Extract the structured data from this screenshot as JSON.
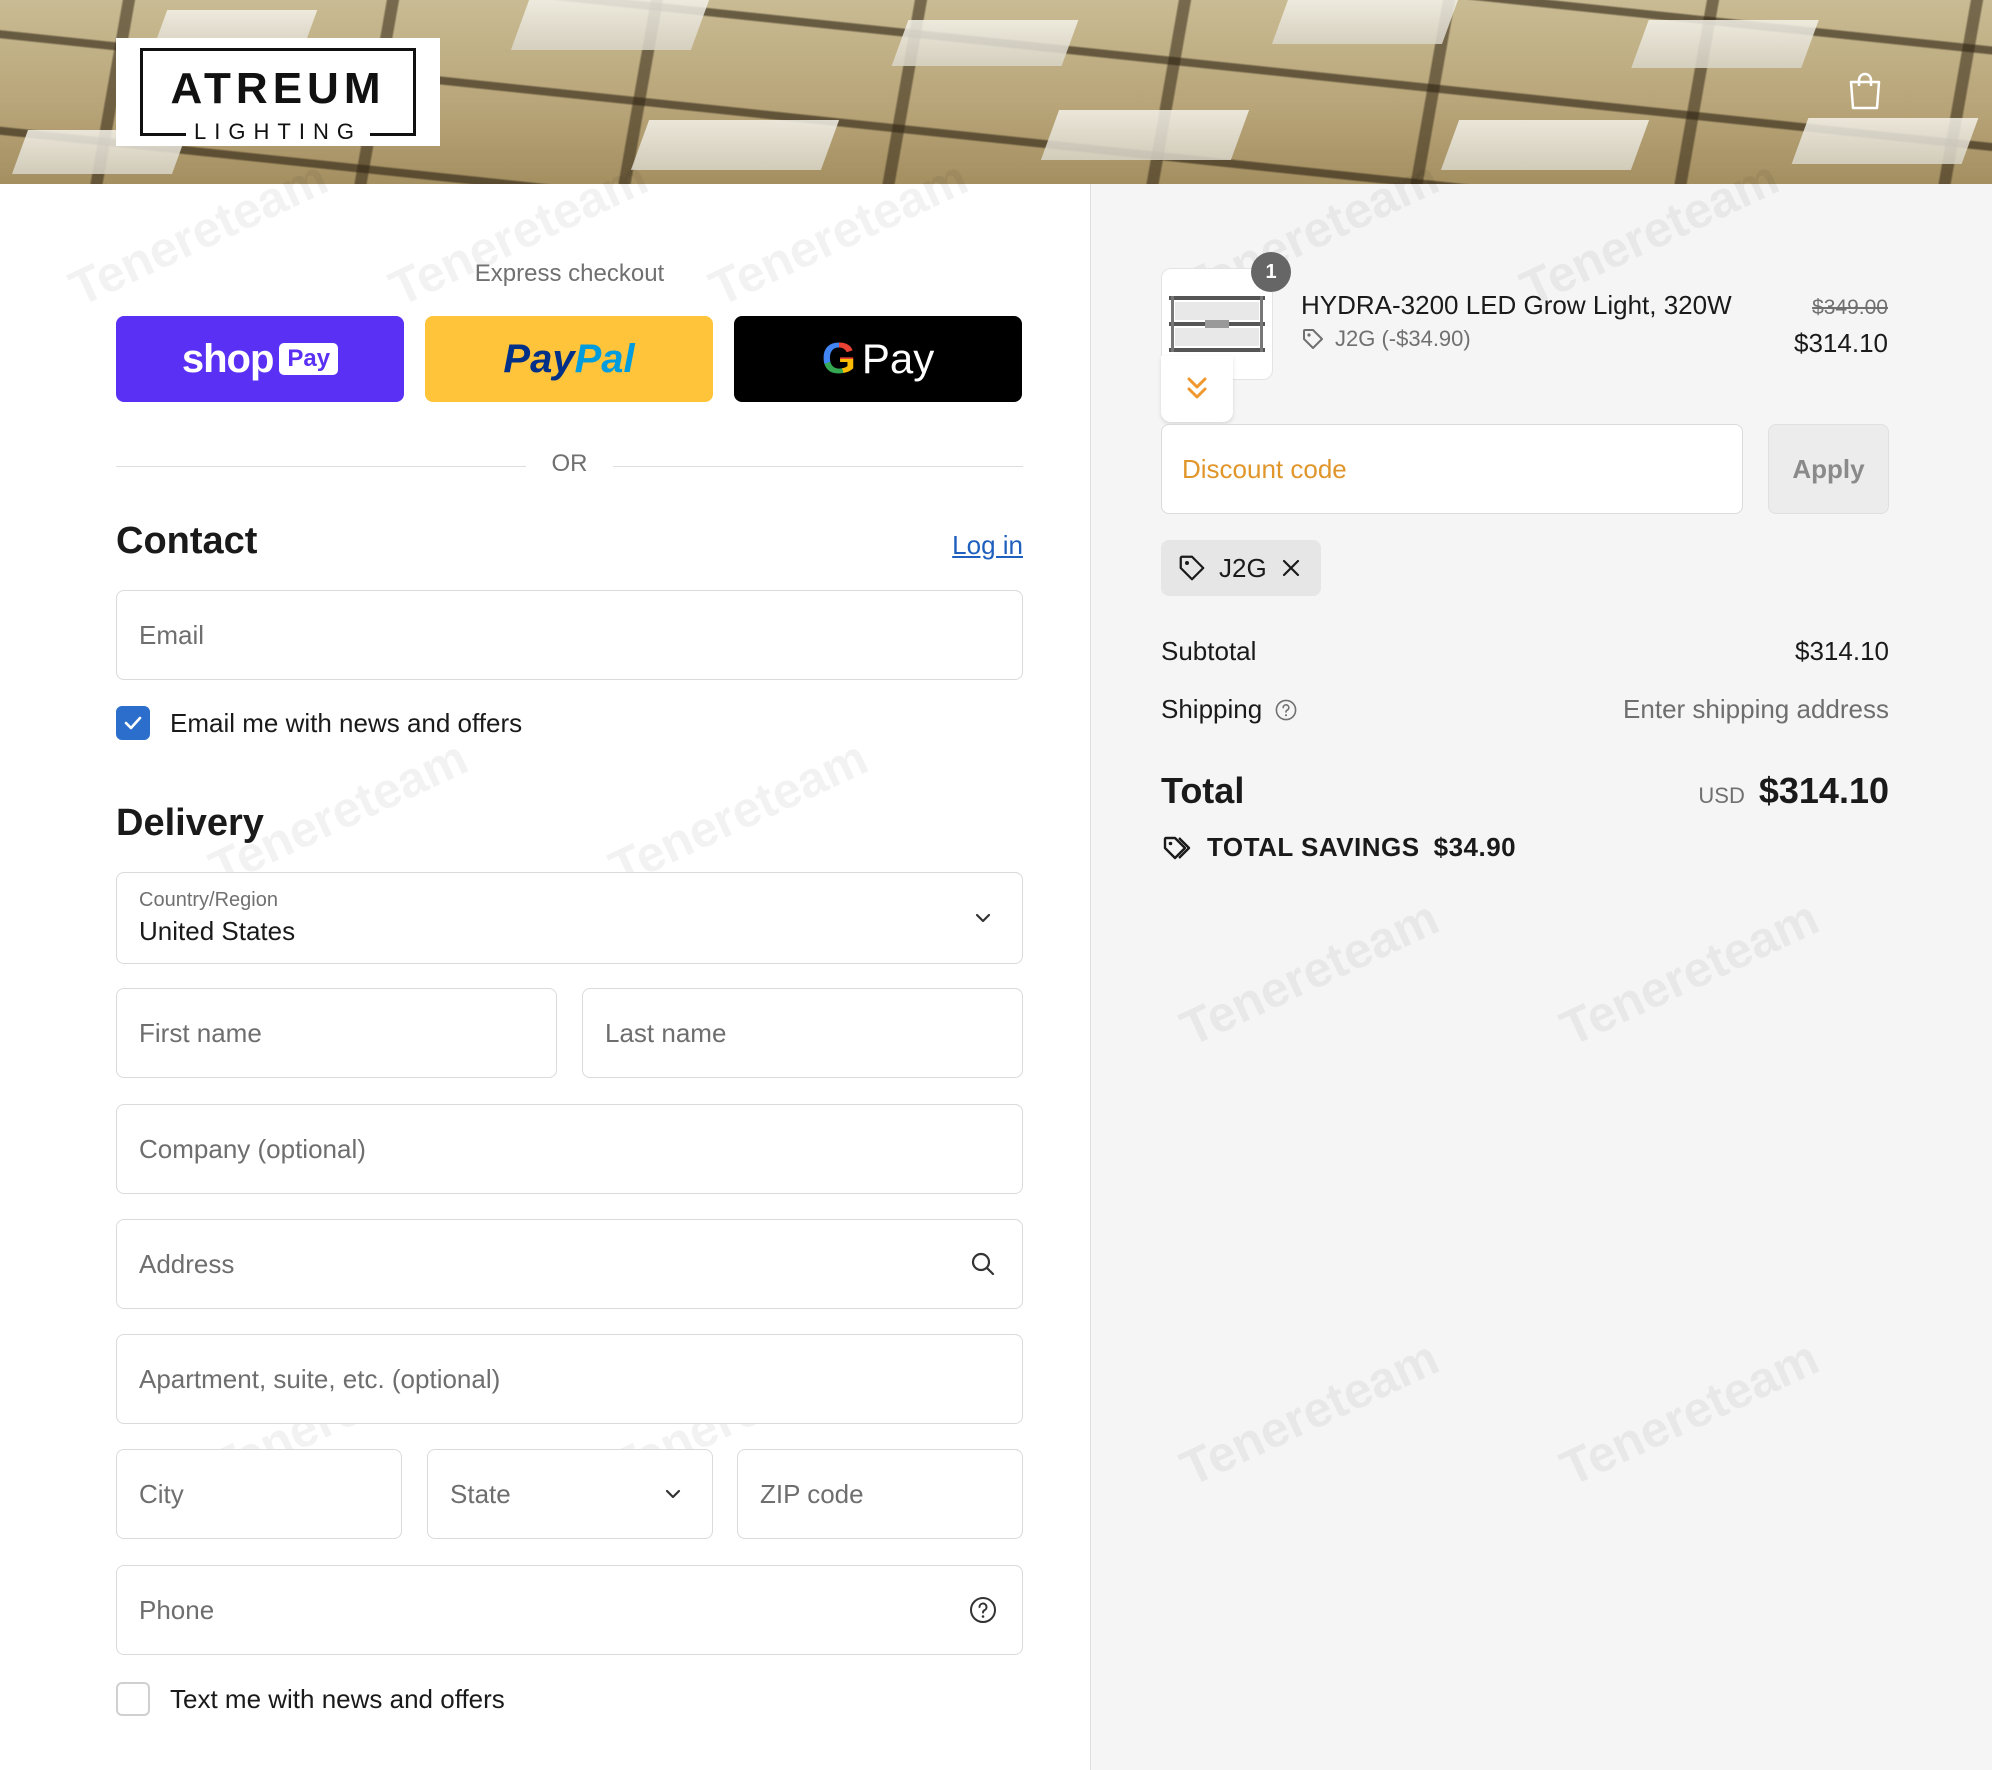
{
  "header": {
    "logo_main": "ATREUM",
    "logo_sub": "LIGHTING"
  },
  "express": {
    "title": "Express checkout",
    "shop_label": "shop",
    "shop_pay_label": "Pay",
    "paypal_part1": "Pay",
    "paypal_part2": "Pal",
    "gpay_g": "G",
    "gpay_label": "Pay",
    "or_label": "OR"
  },
  "contact": {
    "title": "Contact",
    "login_label": "Log in",
    "email_placeholder": "Email",
    "newsletter_label": "Email me with news and offers",
    "newsletter_checked": true
  },
  "delivery": {
    "title": "Delivery",
    "country_label": "Country/Region",
    "country_value": "United States",
    "first_name_placeholder": "First name",
    "last_name_placeholder": "Last name",
    "company_placeholder": "Company (optional)",
    "address_placeholder": "Address",
    "apartment_placeholder": "Apartment, suite, etc. (optional)",
    "city_placeholder": "City",
    "state_placeholder": "State",
    "zip_placeholder": "ZIP code",
    "phone_placeholder": "Phone",
    "sms_label": "Text me with news and offers",
    "sms_checked": false
  },
  "summary": {
    "item": {
      "quantity": "1",
      "name": "HYDRA-3200 LED Grow Light, 320W",
      "discount": "J2G (-$34.90)",
      "price_original": "$349.00",
      "price_final": "$314.10"
    },
    "discount_placeholder": "Discount code",
    "apply_label": "Apply",
    "applied_code": "J2G",
    "subtotal_label": "Subtotal",
    "subtotal_value": "$314.10",
    "shipping_label": "Shipping",
    "shipping_value": "Enter shipping address",
    "total_label": "Total",
    "currency": "USD",
    "total_value": "$314.10",
    "savings_label": "TOTAL SAVINGS",
    "savings_value": "$34.90"
  },
  "colors": {
    "shop_pay": "#5a31f4",
    "paypal": "#ffc439",
    "link": "#1f5fbd",
    "checkbox": "#2c6ecb",
    "discount_placeholder": "#e0962a"
  }
}
